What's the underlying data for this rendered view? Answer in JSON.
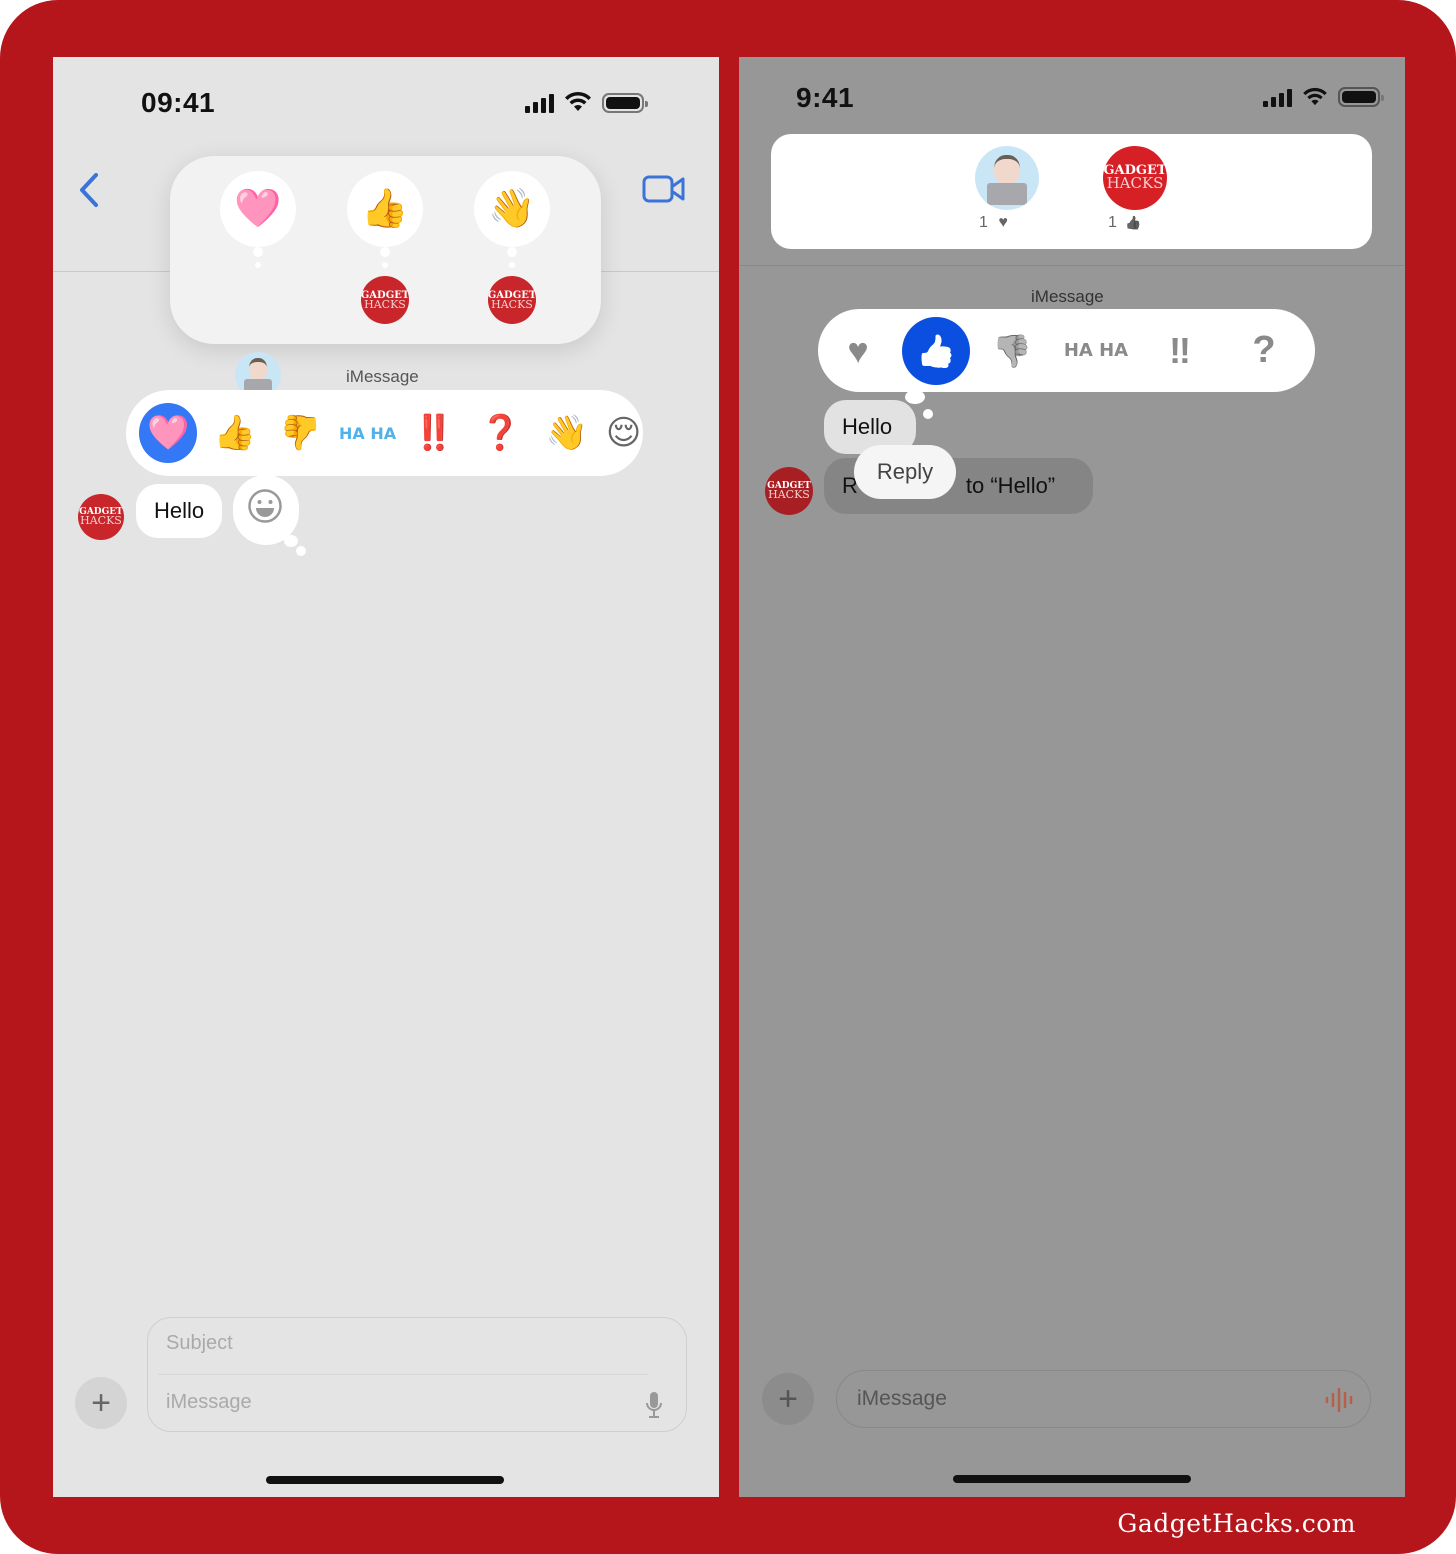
{
  "watermark": "GadgetHacks.com",
  "left_screen": {
    "status_bar": {
      "time": "09:41"
    },
    "nav": {
      "back_icon": "chevron-left-icon",
      "video_icon": "video-camera-icon"
    },
    "reactions_card": {
      "items": [
        {
          "emoji": "🩷",
          "name": "heart",
          "reactor": "memoji"
        },
        {
          "emoji": "👍",
          "name": "thumbs-up",
          "reactor": "gadget-hacks"
        },
        {
          "emoji": "👋",
          "name": "waving-hand",
          "reactor": "gadget-hacks"
        }
      ]
    },
    "service_label": "iMessage",
    "tapback_bar": {
      "items": [
        {
          "emoji": "🩷",
          "name": "heart",
          "selected": true
        },
        {
          "emoji": "👍",
          "name": "thumbs-up"
        },
        {
          "emoji": "👎",
          "name": "thumbs-down"
        },
        {
          "label": "HA HA",
          "name": "haha"
        },
        {
          "emoji": "‼️",
          "name": "exclamation"
        },
        {
          "emoji": "❓",
          "name": "question"
        },
        {
          "emoji": "👋",
          "name": "waving-hand"
        },
        {
          "emoji": "😌",
          "name": "partial-emoji"
        }
      ]
    },
    "message": {
      "text": "Hello",
      "sender_avatar_top": "GADGET",
      "sender_avatar_bottom": "HACKS"
    },
    "emoji_picker_icon": "smiley-icon",
    "compose": {
      "subject_placeholder": "Subject",
      "message_placeholder": "iMessage",
      "plus_label": "+",
      "mic_icon": "microphone-icon"
    }
  },
  "right_screen": {
    "status_bar": {
      "time": "9:41"
    },
    "reactions_summary": {
      "items": [
        {
          "reactor": "memoji",
          "count": "1",
          "icon": "♥"
        },
        {
          "reactor": "gadget-hacks",
          "count": "1",
          "icon": "👍"
        }
      ]
    },
    "service_label": "iMessage",
    "tapback_bar": {
      "items": [
        {
          "glyph": "♥",
          "name": "heart"
        },
        {
          "glyph": "👍",
          "name": "thumbs-up",
          "selected": true
        },
        {
          "glyph": "👎",
          "name": "thumbs-down"
        },
        {
          "label": "HA HA",
          "name": "haha"
        },
        {
          "glyph": "‼",
          "name": "exclamation"
        },
        {
          "glyph": "?",
          "name": "question"
        }
      ]
    },
    "message": {
      "text": "Hello"
    },
    "reaction_message": {
      "prefix": "R",
      "suffix": "to “Hello”"
    },
    "reply_button": "Reply",
    "compose": {
      "message_placeholder": "iMessage",
      "plus_label": "+",
      "audio_icon": "waveform-icon"
    }
  },
  "avatar_text": {
    "top": "GADGET",
    "bottom": "HACKS"
  }
}
